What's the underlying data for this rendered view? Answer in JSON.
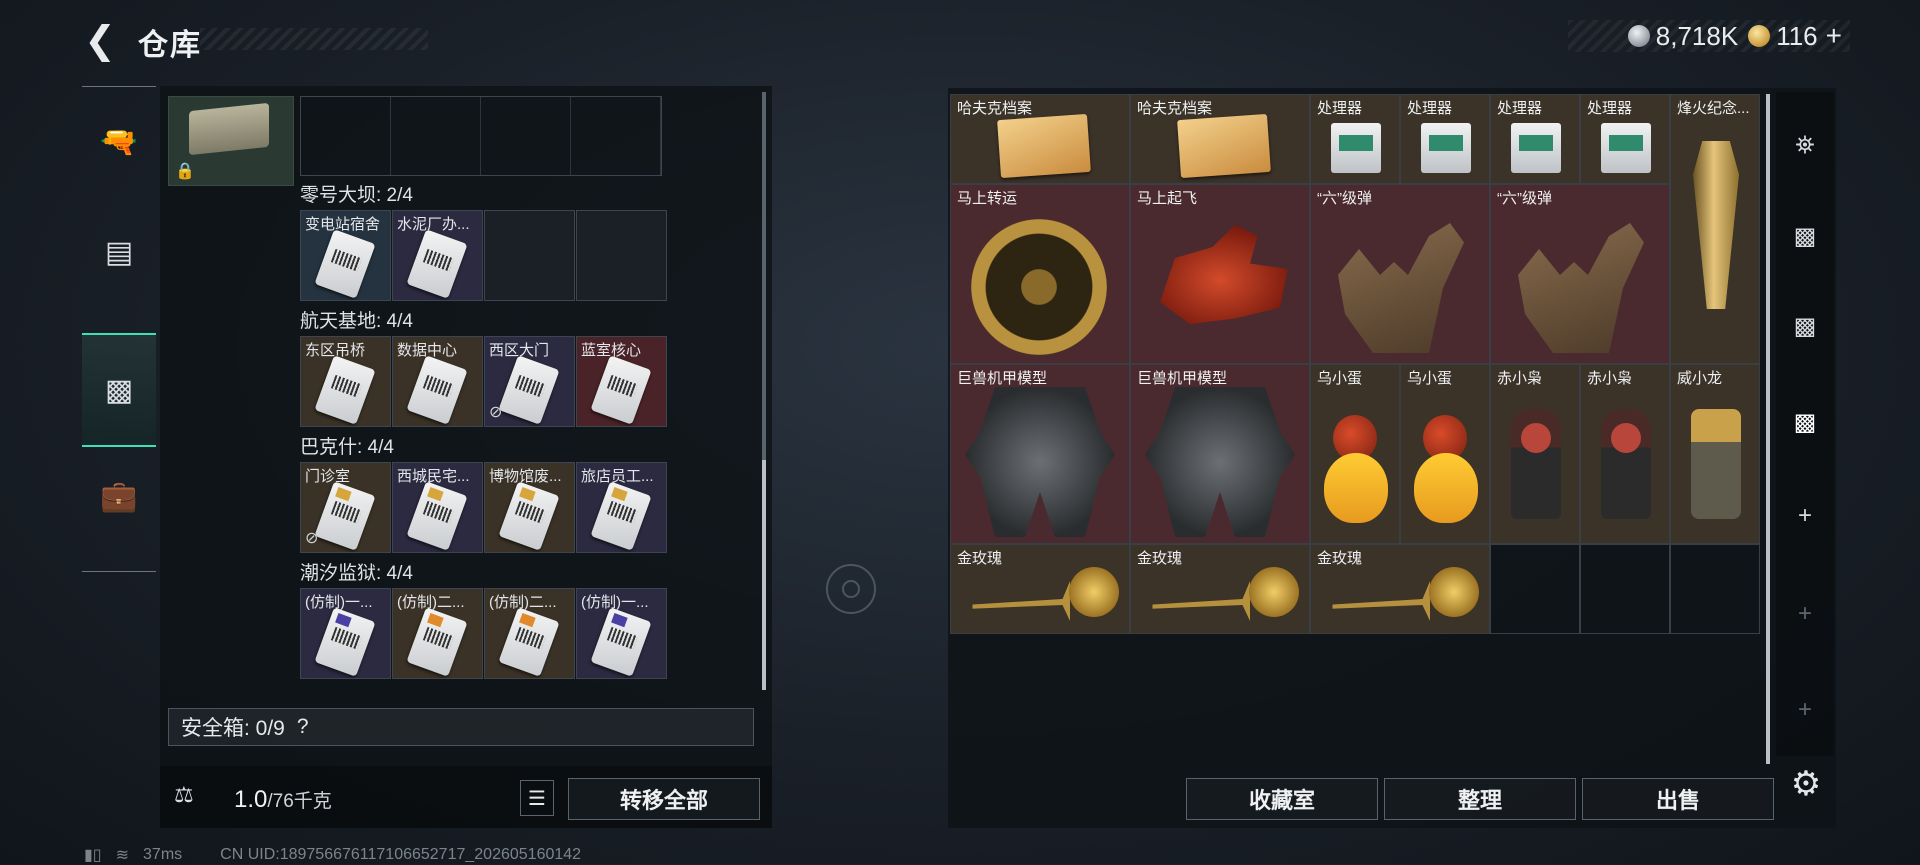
{
  "header": {
    "title": "仓库",
    "currency": [
      {
        "icon": "silver-coin-icon",
        "value": "8,718K"
      },
      {
        "icon": "gold-coin-icon",
        "value": "116"
      }
    ],
    "plus": "+"
  },
  "left_nav": [
    "gun-icon",
    "backpack-icon",
    "storage-box-icon",
    "toolbox-icon"
  ],
  "sections": [
    {
      "label": "零号大坝: 2/4",
      "cells": [
        {
          "name": "变电站宿舍",
          "bg": "bg-blue",
          "card": ""
        },
        {
          "name": "水泥厂办...",
          "bg": "bg-purple",
          "card": ""
        },
        {
          "name": "",
          "bg": "",
          "card": "none"
        },
        {
          "name": "",
          "bg": "",
          "card": "none"
        }
      ]
    },
    {
      "label": "航天基地: 4/4",
      "cells": [
        {
          "name": "东区吊桥",
          "bg": "bg-gold",
          "card": ""
        },
        {
          "name": "数据中心",
          "bg": "bg-gold",
          "card": ""
        },
        {
          "name": "西区大门",
          "bg": "bg-purple",
          "card": "",
          "mark": true
        },
        {
          "name": "蓝室核心",
          "bg": "bg-red",
          "card": ""
        }
      ]
    },
    {
      "label": "巴克什: 4/4",
      "cells": [
        {
          "name": "门诊室",
          "bg": "bg-gold",
          "card": "gold",
          "mark": true
        },
        {
          "name": "西城民宅...",
          "bg": "bg-purple",
          "card": "gold"
        },
        {
          "name": "博物馆废...",
          "bg": "bg-gold",
          "card": "gold"
        },
        {
          "name": "旅店员工...",
          "bg": "bg-purple",
          "card": "gold"
        }
      ]
    },
    {
      "label": "潮汐监狱: 4/4",
      "cells": [
        {
          "name": "(仿制)一...",
          "bg": "bg-purple",
          "card": "purple"
        },
        {
          "name": "(仿制)二...",
          "bg": "bg-gold",
          "card": "orange"
        },
        {
          "name": "(仿制)二...",
          "bg": "bg-gold",
          "card": "orange"
        },
        {
          "name": "(仿制)一...",
          "bg": "bg-purple",
          "card": "purple"
        }
      ]
    }
  ],
  "safebox": {
    "label": "安全箱: 0/9",
    "help": "?"
  },
  "weight": {
    "current": "1.0",
    "max": "/76千克"
  },
  "buttons": {
    "transfer_all": "转移全部",
    "collection": "收藏室",
    "organize": "整理",
    "sell": "出售"
  },
  "right_items": {
    "folder1": "哈夫克档案",
    "folder2": "哈夫克档案",
    "proc1": "处理器",
    "proc2": "处理器",
    "proc3": "处理器",
    "proc4": "处理器",
    "trophy": "烽火纪念...",
    "wheel": "马上转运",
    "horse": "马上起飞",
    "hand1": "“六”级弹",
    "hand2": "“六”级弹",
    "mech1": "巨兽机甲模型",
    "mech2": "巨兽机甲模型",
    "egg1": "乌小蛋",
    "egg2": "乌小蛋",
    "owl1": "赤小枭",
    "owl2": "赤小枭",
    "dragon": "威小龙",
    "rose1": "金玫瑰",
    "rose2": "金玫瑰",
    "rose3": "金玫瑰"
  },
  "right_nav": [
    "vault-icon",
    "v-storage-icon",
    "iv-storage-icon",
    "iv-storage-active-icon",
    "add-icon",
    "add-icon",
    "add-icon"
  ],
  "footer": {
    "ping": "37ms",
    "uid": "CN UID:18975667611710665271​7_202605160142"
  },
  "colors": {
    "accent": "#3ee0b8",
    "rare_red": "#4a2a2e",
    "rare_gold": "#3b3228"
  }
}
